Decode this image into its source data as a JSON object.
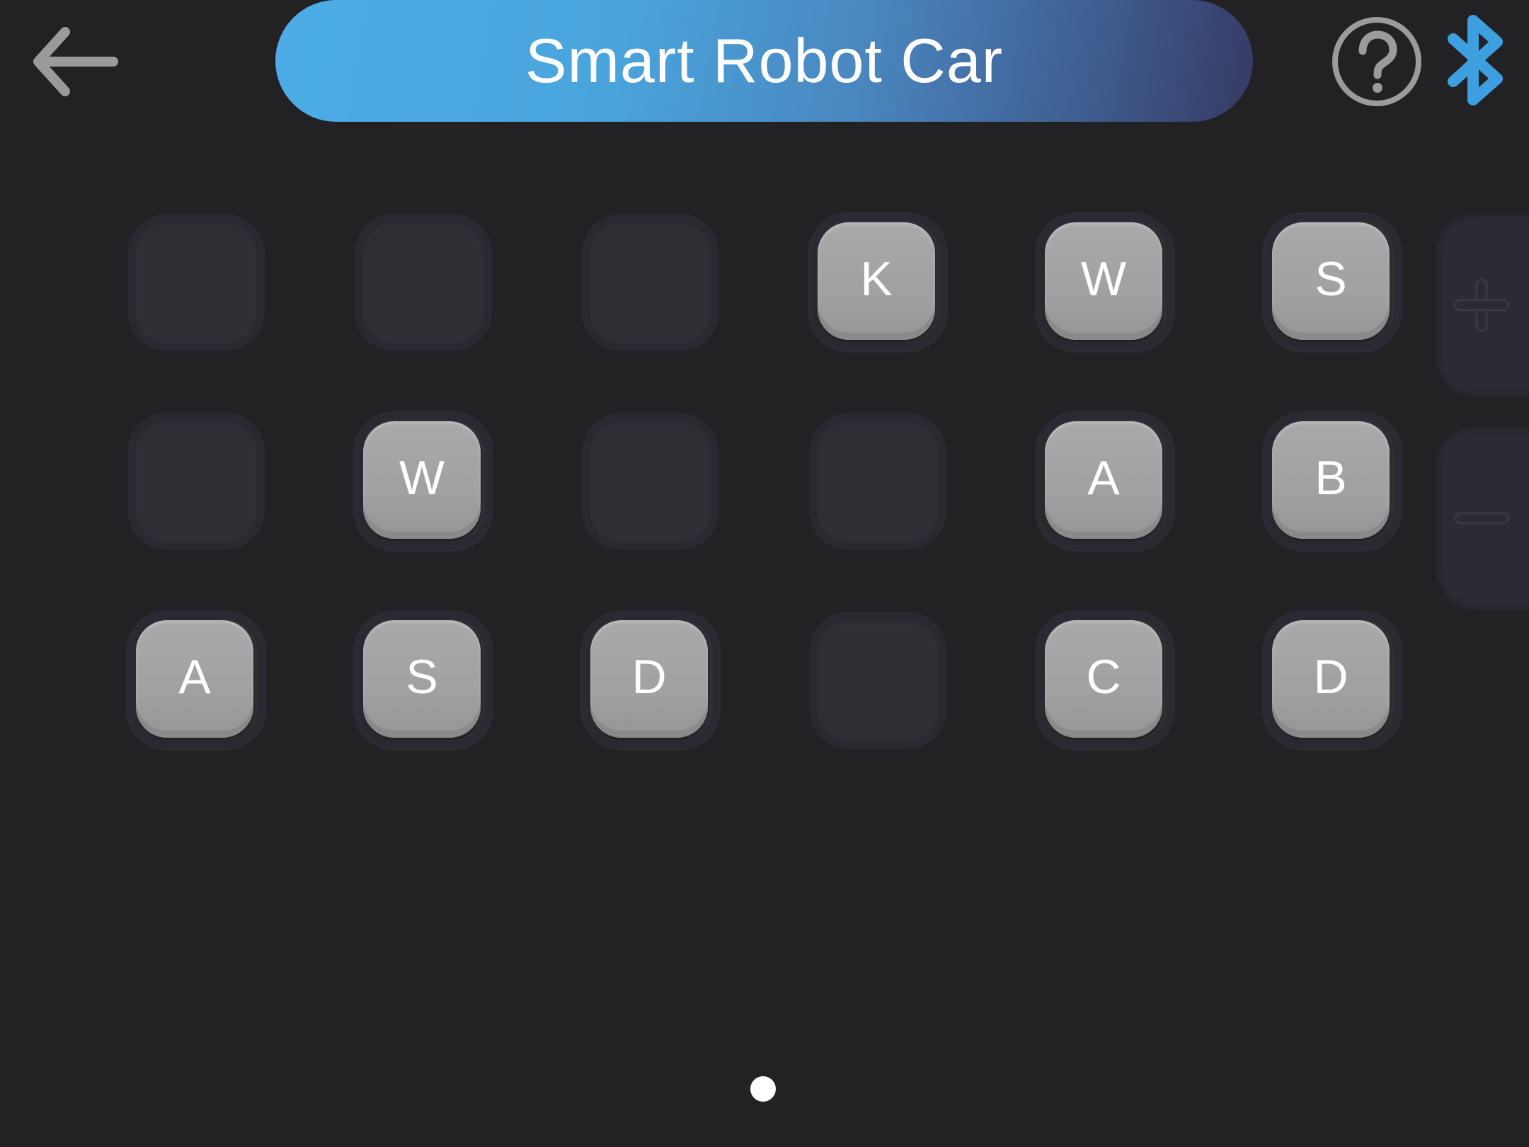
{
  "header": {
    "title": "Smart Robot Car",
    "back_icon": "arrow-left-icon",
    "help_icon": "question-circle-icon",
    "bluetooth_icon": "bluetooth-icon",
    "title_gradient": [
      "#4dade6",
      "#363a63"
    ],
    "bluetooth_color": "#3d9fe0"
  },
  "grid": {
    "rows": [
      [
        "",
        "",
        "",
        "K",
        "W",
        "S"
      ],
      [
        "",
        "W",
        "",
        "",
        "A",
        "B"
      ],
      [
        "A",
        "S",
        "D",
        "",
        "C",
        "D"
      ]
    ]
  },
  "side_controls": {
    "plus_icon": "plus-icon",
    "minus_icon": "minus-icon"
  },
  "pager": {
    "pages": 1,
    "current": 1
  }
}
